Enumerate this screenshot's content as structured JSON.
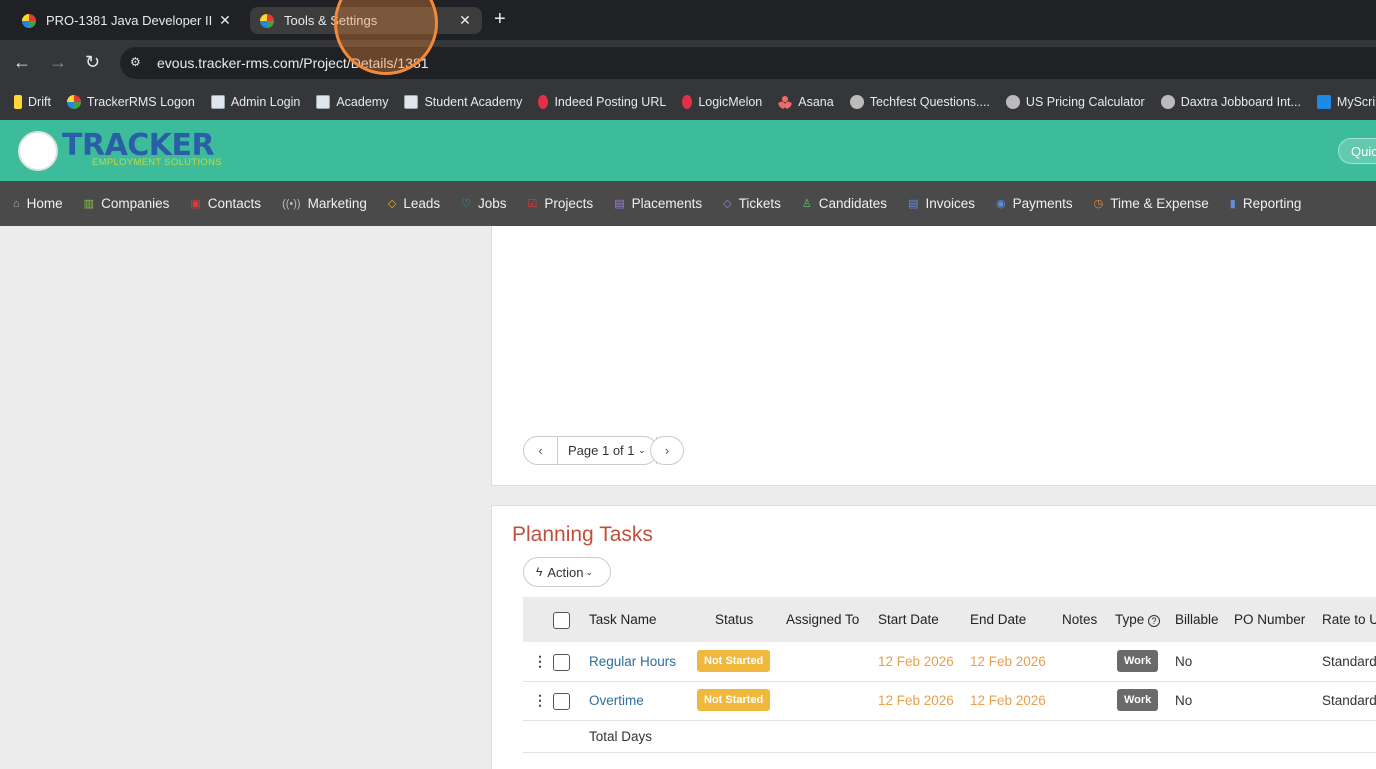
{
  "browser": {
    "tabs": [
      {
        "title": "PRO-1381 Java Developer II"
      },
      {
        "title": "Tools & Settings"
      }
    ],
    "url": "evous.tracker-rms.com/Project/Details/1381",
    "bookmarks": [
      {
        "label": "Drift",
        "icon": "drift-icon"
      },
      {
        "label": "TrackerRMS Logon",
        "icon": "tracker-icon"
      },
      {
        "label": "Admin Login",
        "icon": "page-icon"
      },
      {
        "label": "Academy",
        "icon": "page-icon"
      },
      {
        "label": "Student Academy",
        "icon": "page-icon"
      },
      {
        "label": "Indeed Posting URL",
        "icon": "indeed-icon"
      },
      {
        "label": "LogicMelon",
        "icon": "logicmelon-icon"
      },
      {
        "label": "Asana",
        "icon": "asana-icon"
      },
      {
        "label": "Techfest Questions....",
        "icon": "globe-icon"
      },
      {
        "label": "US Pricing Calculator",
        "icon": "globe-icon"
      },
      {
        "label": "Daxtra Jobboard Int...",
        "icon": "globe-icon"
      },
      {
        "label": "MyScripp",
        "icon": "myscripp-icon"
      }
    ]
  },
  "app": {
    "logo_text": "TRACKER",
    "logo_sub": "EMPLOYMENT SOLUTIONS",
    "quick_label": "Quic",
    "menu": [
      {
        "label": "Home",
        "color": "#b0b0b0",
        "icon": "⌂"
      },
      {
        "label": "Companies",
        "color": "#8bc34a",
        "icon": "▥"
      },
      {
        "label": "Contacts",
        "color": "#e53935",
        "icon": "▣"
      },
      {
        "label": "Marketing",
        "color": "#bdbdbd",
        "icon": "((•))"
      },
      {
        "label": "Leads",
        "color": "#f4b400",
        "icon": "◇"
      },
      {
        "label": "Jobs",
        "color": "#29b6f6",
        "icon": "♡"
      },
      {
        "label": "Projects",
        "color": "#e53935",
        "icon": "☑"
      },
      {
        "label": "Placements",
        "color": "#9c7ce0",
        "icon": "▤"
      },
      {
        "label": "Tickets",
        "color": "#9c7ce0",
        "icon": "◇"
      },
      {
        "label": "Candidates",
        "color": "#66bb6a",
        "icon": "♙"
      },
      {
        "label": "Invoices",
        "color": "#5c8de0",
        "icon": "▤"
      },
      {
        "label": "Payments",
        "color": "#5c8de0",
        "icon": "◉"
      },
      {
        "label": "Time & Expense",
        "color": "#f28a3a",
        "icon": "◷"
      },
      {
        "label": "Reporting",
        "color": "#5c8de0",
        "icon": "▮"
      }
    ]
  },
  "pager": {
    "label": "Page 1 of 1"
  },
  "planning": {
    "title": "Planning Tasks",
    "action_label": "Action",
    "columns": [
      "Task Name",
      "Status",
      "Assigned To",
      "Start Date",
      "End Date",
      "Notes",
      "Type",
      "Billable",
      "PO Number",
      "Rate to U"
    ],
    "rows": [
      {
        "task": "Regular Hours",
        "status": "Not Started",
        "assigned": "",
        "start": "12 Feb 2026",
        "end": "12 Feb 2026",
        "notes": "",
        "type": "Work",
        "billable": "No",
        "po": "",
        "rate": "Standard"
      },
      {
        "task": "Overtime",
        "status": "Not Started",
        "assigned": "",
        "start": "12 Feb 2026",
        "end": "12 Feb 2026",
        "notes": "",
        "type": "Work",
        "billable": "No",
        "po": "",
        "rate": "Standard"
      }
    ],
    "total_label": "Total Days"
  },
  "colors": {
    "header": "#3dbc9c",
    "menu": "#4a4a4a",
    "title": "#c0503a",
    "link": "#2b6f9a",
    "date": "#e8a04a",
    "not_started": "#f0b83c",
    "work": "#6a6a6a"
  }
}
